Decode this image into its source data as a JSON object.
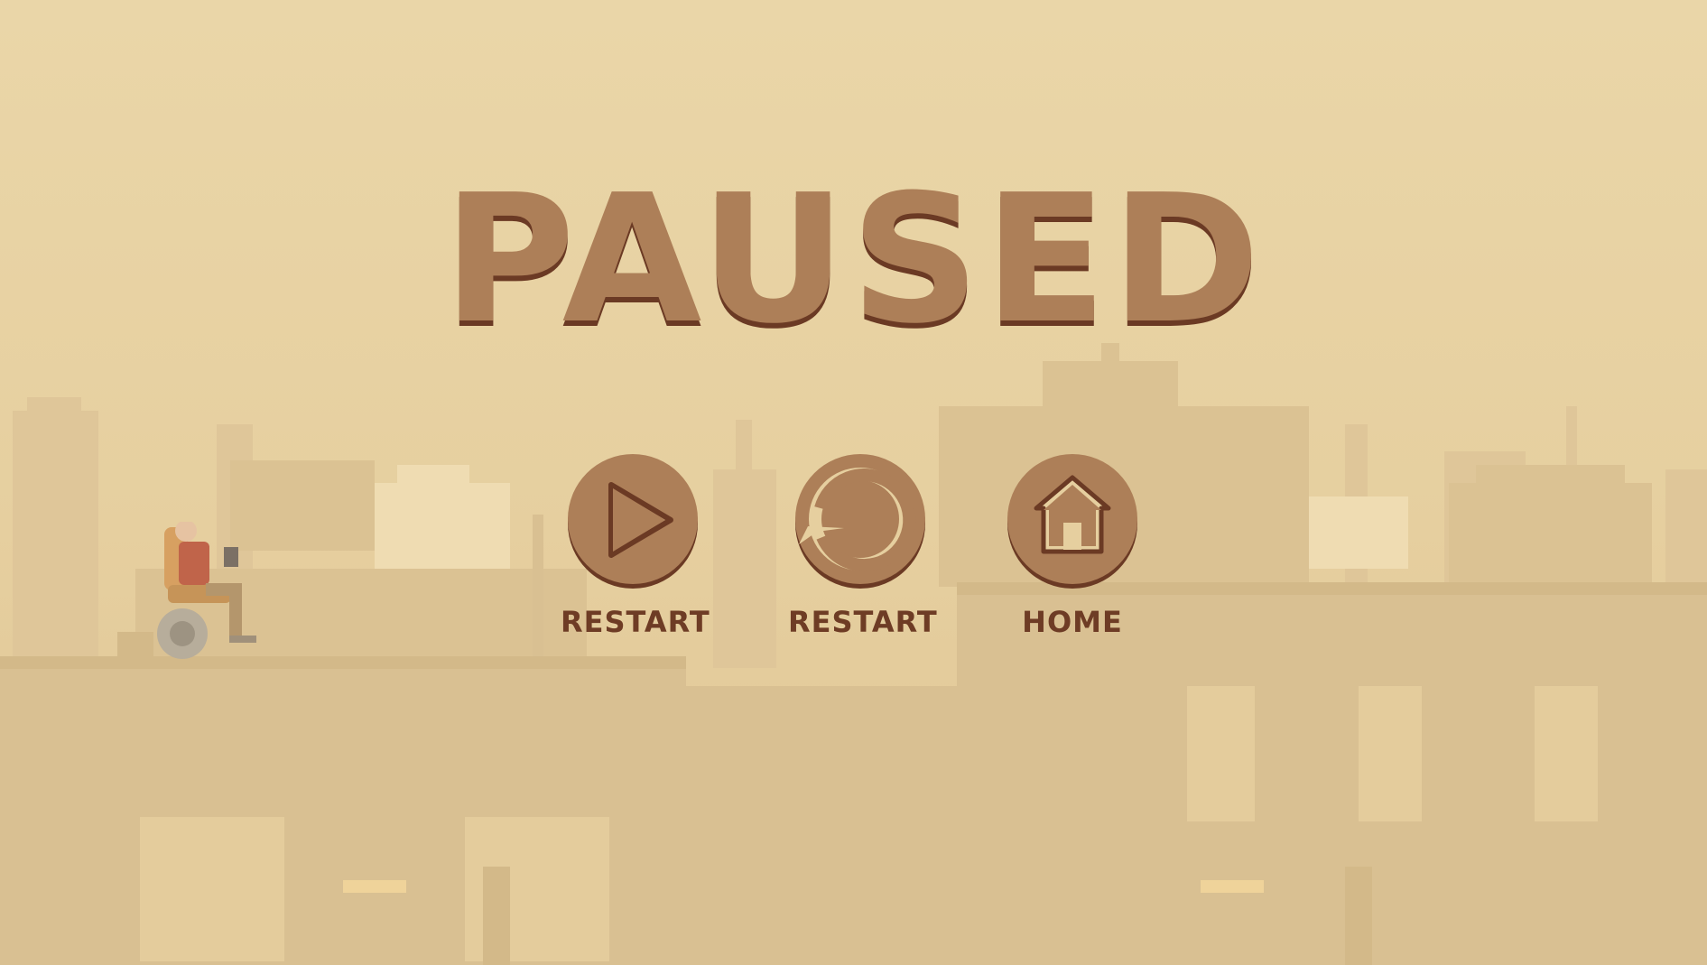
{
  "screen": {
    "title": "PAUSED"
  },
  "menu": {
    "buttons": [
      {
        "label": "RESTART",
        "icon": "play-icon"
      },
      {
        "label": "RESTART",
        "icon": "restart-icon"
      },
      {
        "label": "HOME",
        "icon": "home-icon"
      }
    ]
  },
  "colors": {
    "background": "#e9d4a6",
    "accent": "#ad7f58",
    "shadow": "#6b3a24",
    "label": "#6e3c25"
  }
}
